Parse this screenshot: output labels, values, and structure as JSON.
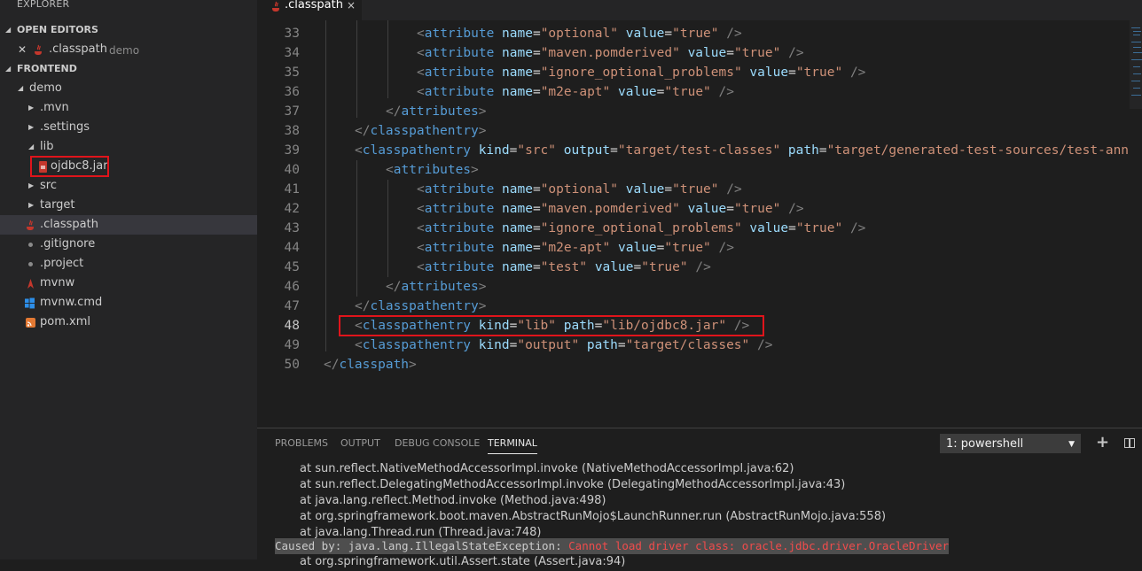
{
  "sidebar": {
    "title": "EXPLORER",
    "open_editors_title": "OPEN EDITORS",
    "open_editor": {
      "name": ".classpath",
      "desc": "demo"
    },
    "folder_title": "FRONTEND",
    "tree": [
      {
        "label": "demo",
        "type": "folder-open"
      },
      {
        "label": ".mvn",
        "type": "folder"
      },
      {
        "label": ".settings",
        "type": "folder"
      },
      {
        "label": "lib",
        "type": "folder-open"
      },
      {
        "label": "ojdbc8.jar",
        "type": "jar-file"
      },
      {
        "label": "src",
        "type": "folder"
      },
      {
        "label": "target",
        "type": "folder"
      },
      {
        "label": ".classpath",
        "type": "java-file"
      },
      {
        "label": ".gitignore",
        "type": "file"
      },
      {
        "label": ".project",
        "type": "file"
      },
      {
        "label": "mvnw",
        "type": "maven-file"
      },
      {
        "label": "mvnw.cmd",
        "type": "windows-file"
      },
      {
        "label": "pom.xml",
        "type": "rss-file"
      }
    ]
  },
  "tab": {
    "label": ".classpath",
    "close": "×"
  },
  "editor": {
    "line_numbers": [
      "33",
      "34",
      "35",
      "36",
      "37",
      "38",
      "39",
      "40",
      "41",
      "42",
      "43",
      "44",
      "45",
      "46",
      "47",
      "48",
      "49",
      "50"
    ],
    "highlighted_line": "48",
    "lines": [
      "<attribute name=\"optional\" value=\"true\" />",
      "<attribute name=\"maven.pomderived\" value=\"true\" />",
      "<attribute name=\"ignore_optional_problems\" value=\"true\" />",
      "<attribute name=\"m2e-apt\" value=\"true\" />",
      "</attributes>",
      "</classpathentry>",
      "<classpathentry kind=\"src\" output=\"target/test-classes\" path=\"target/generated-test-sources/test-ann",
      "<attributes>",
      "<attribute name=\"optional\" value=\"true\" />",
      "<attribute name=\"maven.pomderived\" value=\"true\" />",
      "<attribute name=\"ignore_optional_problems\" value=\"true\" />",
      "<attribute name=\"m2e-apt\" value=\"true\" />",
      "<attribute name=\"test\" value=\"true\" />",
      "</attributes>",
      "</classpathentry>",
      "<classpathentry kind=\"lib\" path=\"lib/ojdbc8.jar\" />",
      "<classpathentry kind=\"output\" path=\"target/classes\" />",
      "</classpath>"
    ]
  },
  "panel": {
    "tabs": [
      "PROBLEMS",
      "OUTPUT",
      "DEBUG CONSOLE",
      "TERMINAL"
    ],
    "active_tab": "TERMINAL",
    "terminal_select": "1: powershell",
    "add_label": "+",
    "terminal_lines": [
      "at sun.reflect.NativeMethodAccessorImpl.invoke (NativeMethodAccessorImpl.java:62)",
      "at sun.reflect.DelegatingMethodAccessorImpl.invoke (DelegatingMethodAccessorImpl.java:43)",
      "at java.lang.reflect.Method.invoke (Method.java:498)",
      "at org.springframework.boot.maven.AbstractRunMojo$LaunchRunner.run (AbstractRunMojo.java:558)",
      "at java.lang.Thread.run (Thread.java:748)"
    ],
    "caused_prefix": "Caused by: java.lang.IllegalStateException: ",
    "caused_message": "Cannot load driver class: oracle.jdbc.driver.OracleDriver",
    "partial_line": "at org.springframework.util.Assert.state (Assert.java:94)"
  },
  "colors": {
    "tag": "#569cd6",
    "attr": "#9cdcfe",
    "string": "#ce9178",
    "highlight_box": "#e0141b",
    "error": "#f14c4c"
  }
}
